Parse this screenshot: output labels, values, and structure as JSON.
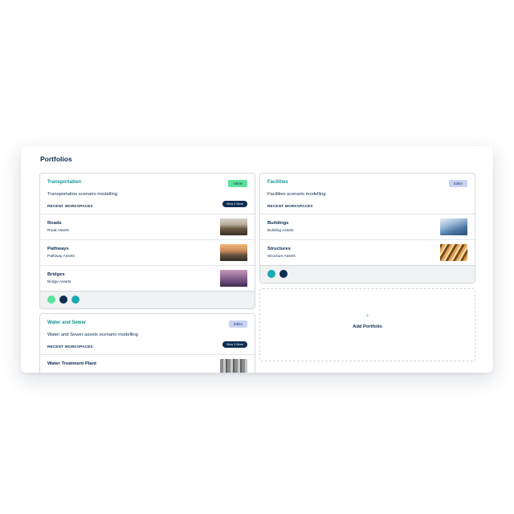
{
  "page": {
    "title": "Portfolios"
  },
  "portfolios": [
    {
      "name": "Transportation",
      "role": "Admin",
      "description": "Transportation scenario modelling",
      "recent_label": "RECENT WORKSPACES",
      "view_more": "View 2 More",
      "workspaces": [
        {
          "title": "Roads",
          "subtitle": "Road Assets",
          "image": "road-photo"
        },
        {
          "title": "Pathways",
          "subtitle": "Pathway Assets",
          "image": "pathway-photo"
        },
        {
          "title": "Bridges",
          "subtitle": "Bridge Assets",
          "image": "bridge-photo"
        }
      ],
      "member_colors": [
        "#5ce39b",
        "#0d2d52",
        "#17a9b4"
      ]
    },
    {
      "name": "Facilities",
      "role": "Editor",
      "description": "Facilities scenario modelling",
      "recent_label": "RECENT WORKSPACES",
      "workspaces": [
        {
          "title": "Buildings",
          "subtitle": "Building Assets",
          "image": "building-photo"
        },
        {
          "title": "Structures",
          "subtitle": "Structure Assets",
          "image": "structure-photo"
        }
      ],
      "member_colors": [
        "#17a9b4",
        "#0d2d52"
      ]
    },
    {
      "name": "Water and Sewer",
      "role": "Editor",
      "description": "Water and Sewer assets scenario modelling",
      "recent_label": "RECENT WORKSPACES",
      "view_more": "View 3 More",
      "workspaces": [
        {
          "title": "Water Treatment Plant",
          "image": "water-plant-photo"
        }
      ]
    }
  ],
  "add_portfolio": {
    "icon": "plus-icon",
    "label": "Add Portfolio"
  },
  "colors": {
    "accent_teal": "#11968f",
    "navy": "#0d2d52",
    "admin_green": "#5ce39b",
    "editor_lavender": "#c9d2f5"
  }
}
